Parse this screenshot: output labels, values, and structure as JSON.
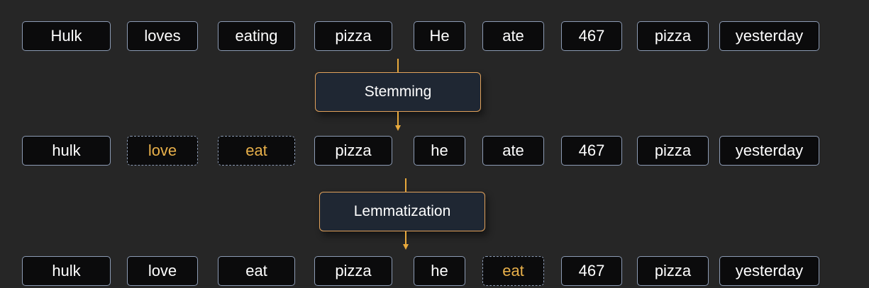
{
  "colors": {
    "background": "#262626",
    "token_fill": "#0b0b0c",
    "token_border": "#8c9bb4",
    "changed_text": "#e8b04a",
    "step_fill": "#1f2733",
    "step_border": "#e2a25b",
    "arrow": "#e8a93c"
  },
  "rows": {
    "original": {
      "tokens": [
        "Hulk",
        "loves",
        "eating",
        "pizza",
        "He",
        "ate",
        "467",
        "pizza",
        "yesterday"
      ]
    },
    "stemmed": {
      "tokens": [
        "hulk",
        "love",
        "eat",
        "pizza",
        "he",
        "ate",
        "467",
        "pizza",
        "yesterday"
      ],
      "changed": [
        false,
        true,
        true,
        false,
        false,
        false,
        false,
        false,
        false
      ]
    },
    "lemmatized": {
      "tokens": [
        "hulk",
        "love",
        "eat",
        "pizza",
        "he",
        "eat",
        "467",
        "pizza",
        "yesterday"
      ],
      "changed": [
        false,
        false,
        false,
        false,
        false,
        true,
        false,
        false,
        false
      ]
    }
  },
  "steps": {
    "stemming": "Stemming",
    "lemmatization": "Lemmatization"
  }
}
